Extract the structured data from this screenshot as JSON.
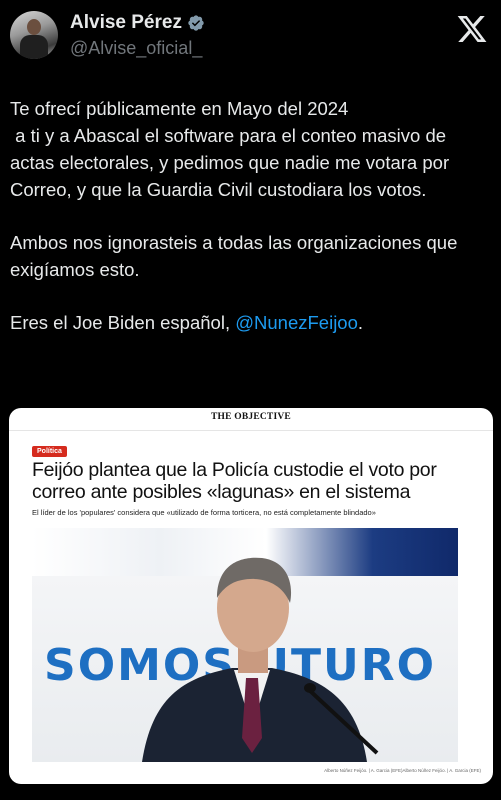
{
  "author": {
    "name": "Alvise Pérez",
    "handle": "@Alvise_oficial_",
    "verified": true
  },
  "brand_icon": "x-logo-icon",
  "tweet": {
    "paragraphs": [
      "Te ofrecí públicamente en Mayo del 2024\n a ti y a Abascal el software para el conteo masivo de actas electorales, y pedimos que nadie me votara por Correo, y que la Guardia Civil custodiara los votos.",
      "Ambos nos ignorasteis a todas las organizaciones que exigíamos esto."
    ],
    "last_line_text": "Eres el Joe Biden español, ",
    "mention": "@NunezFeijoo",
    "last_line_end": "."
  },
  "card": {
    "outlet_logo": "THE OBJECTIVE",
    "section": "Política",
    "headline": "Feijóo plantea que la Policía custodie el voto por correo ante posibles «lagunas» en el sistema",
    "dek": "El líder de los 'populares' considera que «utilizado de forma torticera, no está completamente blindado»",
    "photo_text": "SOMOS   UTURO",
    "photo_caption": "Alberto Núñez Feijóo. | A. Garcia (EFE)Alberto Núñez Feijóo. | A. Garcia (EFE)"
  },
  "colors": {
    "background": "#000000",
    "text": "#e7e9ea",
    "muted": "#71767b",
    "link": "#1d9bf0",
    "verified": "#829aab",
    "badge": "#d52b1e"
  }
}
